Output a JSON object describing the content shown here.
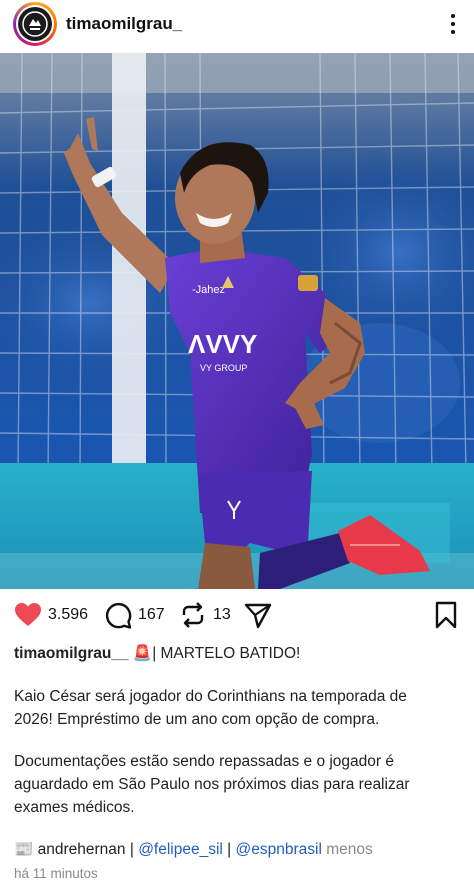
{
  "header": {
    "username": "timaomilgrau_",
    "more_icon": "more-vertical-icon"
  },
  "actions": {
    "likes": "3.596",
    "comments": "167",
    "reposts": "13",
    "like_color": "#ed4956"
  },
  "caption": {
    "username": "timaomilgrau__",
    "siren": "🚨",
    "headline": "| MARTELO BATIDO!",
    "paragraph1_line1": "Kaio César será jogador do Corinthians na temporada de",
    "paragraph1_line2": "2026! Empréstimo de um ano com opção de compra.",
    "paragraph2_line1": "Documentações estão sendo repassadas e o jogador é",
    "paragraph2_line2": "aguardado em São Paulo nos próximos dias para realizar",
    "paragraph2_line3": "exames médicos.",
    "credits_icon": "📰",
    "credit1": "andrehernan",
    "sep1": " | ",
    "credit2": "@felipee_sil",
    "sep2": " | ",
    "credit3": "@espnbrasil",
    "more": "menos"
  },
  "timestamp": "há 11 minutos"
}
